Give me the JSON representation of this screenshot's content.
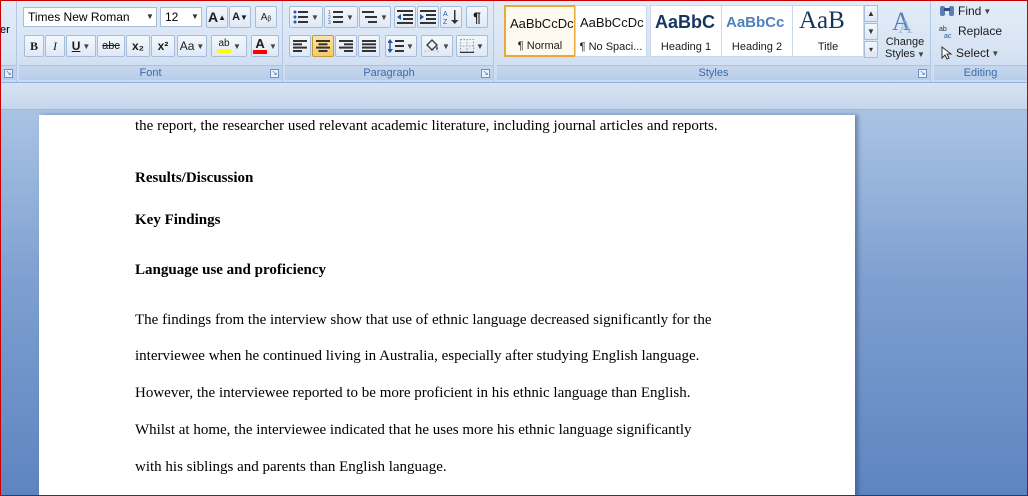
{
  "ribbon": {
    "clipped_left_label": "er",
    "font": {
      "label": "Font",
      "font_name": "Times New Roman",
      "font_size": "12",
      "grow_font": "A",
      "shrink_font": "A",
      "bold": "B",
      "italic": "I",
      "underline": "U",
      "strikethrough": "abc",
      "subscript": "x₂",
      "superscript": "x²",
      "change_case": "Aa",
      "highlight": "ab",
      "font_color": "A"
    },
    "paragraph": {
      "label": "Paragraph",
      "show_marks": "¶"
    },
    "styles": {
      "label": "Styles",
      "items": [
        {
          "preview": "AaBbCcDc",
          "name": "¶ Normal"
        },
        {
          "preview": "AaBbCcDc",
          "name": "¶ No Spaci..."
        },
        {
          "preview": "AaBbC",
          "name": "Heading 1"
        },
        {
          "preview": "AaBbCc",
          "name": "Heading 2"
        },
        {
          "preview": "AaB",
          "name": "Title"
        }
      ],
      "change_styles_line1": "Change",
      "change_styles_line2": "Styles"
    },
    "editing": {
      "label": "Editing",
      "find": "Find",
      "replace": "Replace",
      "select": "Select"
    }
  },
  "colors": {
    "highlight_bar": "#ffff00",
    "font_color_bar": "#ff0000",
    "accent": "#3e6aaa"
  },
  "document": {
    "lines": [
      {
        "text": "the report, the researcher used relevant academic literature, including journal articles and reports.",
        "style": "body"
      },
      {
        "text": "Results/Discussion",
        "style": "heading"
      },
      {
        "text": "Key Findings",
        "style": "heading"
      },
      {
        "text": "Language use and proficiency",
        "style": "heading"
      },
      {
        "text": "The findings from the interview show that use of ethnic language decreased significantly for the",
        "style": "body"
      },
      {
        "text": "interviewee when he continued living in Australia, especially after studying English language.",
        "style": "body"
      },
      {
        "text": "However, the interviewee reported to be more proficient in his ethnic language than English.",
        "style": "body"
      },
      {
        "text": "Whilst at home, the interviewee indicated that he uses more his ethnic language significantly",
        "style": "body"
      },
      {
        "text": "with his siblings and parents than English language.",
        "style": "body"
      }
    ]
  }
}
